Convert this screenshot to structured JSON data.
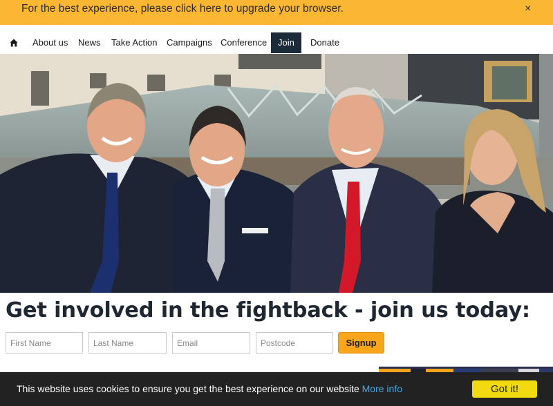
{
  "upgrade_banner": {
    "message": "For the best experience, please click here to upgrade your browser.",
    "close_label": "×"
  },
  "nav": {
    "home_icon": "home-icon",
    "items": [
      {
        "label": "About us"
      },
      {
        "label": "News"
      },
      {
        "label": "Take Action"
      },
      {
        "label": "Campaigns"
      },
      {
        "label": "Conference"
      },
      {
        "label": "Join",
        "active": true
      },
      {
        "label": "Donate"
      }
    ]
  },
  "headline": "Get involved in the fightback - join us today:",
  "signup_form": {
    "first_name_placeholder": "First Name",
    "last_name_placeholder": "Last Name",
    "email_placeholder": "Email",
    "postcode_placeholder": "Postcode",
    "submit_label": "Signup"
  },
  "cookie_bar": {
    "message": "This website uses cookies to ensure you get the best experience on our website",
    "more_info_label": "More info",
    "accept_label": "Got it!"
  },
  "colors": {
    "banner": "#fbb731",
    "nav_active": "#1c2b3a",
    "signup_button": "#f9a51a",
    "cookie_bar": "#222222",
    "cookie_link": "#41a9e6",
    "cookie_button": "#f2da10",
    "headline": "#1f2733"
  }
}
